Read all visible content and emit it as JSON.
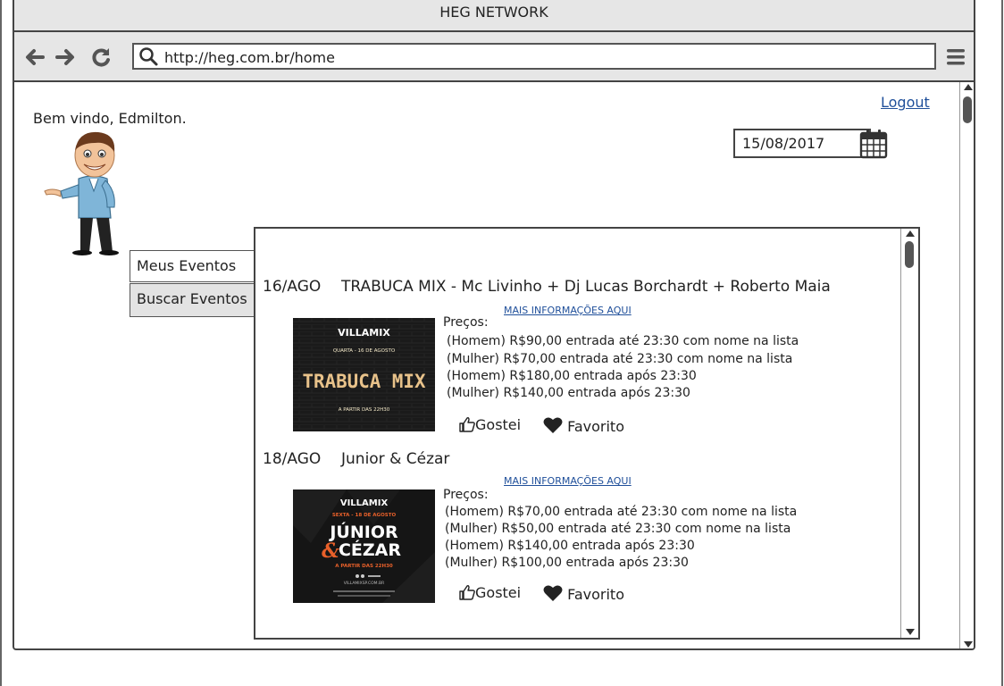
{
  "window": {
    "title": "HEG NETWORK"
  },
  "toolbar": {
    "url": "http://heg.com.br/home"
  },
  "header": {
    "logout_label": "Logout",
    "welcome_text": "Bem vindo, Edmilton.",
    "date_value": "15/08/2017"
  },
  "tabs": [
    {
      "label": "Meus Eventos",
      "active": true
    },
    {
      "label": "Buscar Eventos",
      "active": false
    }
  ],
  "events": [
    {
      "date": "16/AGO",
      "title": "TRABUCA MIX - Mc Livinho + Dj Lucas Borchardt + Roberto Maia",
      "more_link": "MAIS INFORMAÇÕES AQUI",
      "prices_label": "Preços:",
      "prices": [
        "(Homem) R$90,00 entrada até 23:30 com nome na lista",
        "(Mulher) R$70,00 entrada até 23:30 com nome na lista",
        "(Homem) R$180,00 entrada após 23:30",
        "(Mulher) R$140,00 entrada após 23:30"
      ],
      "like_label": "Gostei",
      "favorite_label": "Favorito",
      "poster": {
        "brand": "VILLAMIX",
        "subtitle": "QUARTA - 16 DE AGOSTO",
        "headline": "TRABUCA MIX",
        "footer": "A PARTIR DAS 22H30"
      }
    },
    {
      "date": "18/AGO",
      "title": "Junior & Cézar",
      "more_link": "MAIS INFORMAÇÕES AQUI",
      "prices_label": "Preços:",
      "prices": [
        "(Homem) R$70,00 entrada até 23:30 com nome na lista",
        "(Mulher) R$50,00 entrada até 23:30 com nome na lista",
        "(Homem) R$140,00 entrada após 23:30",
        "(Mulher) R$100,00 entrada após 23:30"
      ],
      "like_label": "Gostei",
      "favorite_label": "Favorito",
      "poster": {
        "brand": "VILLAMIX",
        "subtitle": "SEXTA - 18 DE AGOSTO",
        "headline_1": "JÚNIOR",
        "headline_amp": "&",
        "headline_2": "CÉZAR",
        "footer": "A PARTIR DAS 22H30",
        "website": "VILLAMIXSP.COM.BR"
      }
    }
  ],
  "icons": {
    "back": "arrow-left-icon",
    "forward": "arrow-right-icon",
    "reload": "reload-icon",
    "search": "search-icon",
    "menu": "hamburger-menu-icon",
    "calendar": "calendar-icon",
    "like": "thumbs-up-icon",
    "favorite": "heart-icon"
  },
  "colors": {
    "link": "#1f4f9a",
    "chrome": "#e6e6e6",
    "poster_accent": "#e8602a"
  }
}
